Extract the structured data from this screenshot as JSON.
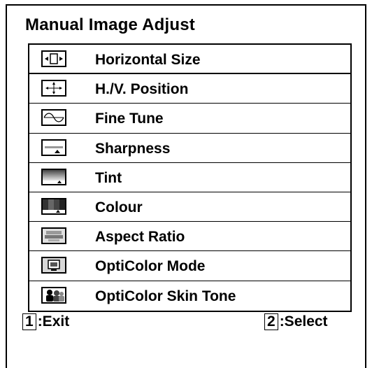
{
  "menu": {
    "title": "Manual Image Adjust",
    "selected_index": 0,
    "items": [
      {
        "label": "Horizontal Size",
        "icon": "horizontal-size-icon"
      },
      {
        "label": "H./V. Position",
        "icon": "position-arrows-icon"
      },
      {
        "label": "Fine Tune",
        "icon": "sine-wave-icon"
      },
      {
        "label": "Sharpness",
        "icon": "sharpness-icon"
      },
      {
        "label": "Tint",
        "icon": "tint-gradient-icon"
      },
      {
        "label": "Colour",
        "icon": "colour-bars-icon"
      },
      {
        "label": "Aspect Ratio",
        "icon": "aspect-ratio-icon"
      },
      {
        "label": "OptiColor Mode",
        "icon": "monitor-icon"
      },
      {
        "label": "OptiColor Skin Tone",
        "icon": "skin-tone-icon"
      }
    ]
  },
  "footer": {
    "exit_key": "1",
    "exit_label": ":Exit",
    "select_key": "2",
    "select_label": ":Select"
  }
}
